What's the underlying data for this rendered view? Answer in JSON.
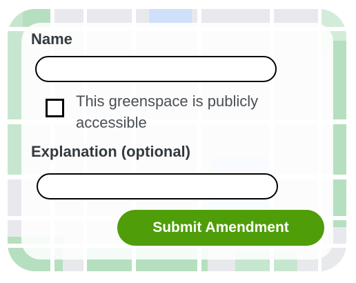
{
  "form": {
    "name_label": "Name",
    "name_value": "",
    "public_checkbox": {
      "label": "This greenspace is publicly accessible",
      "checked": false
    },
    "explanation_label": "Explanation (optional)",
    "explanation_value": "",
    "submit_label": "Submit Amendment"
  },
  "colors": {
    "accent": "#4f9d08",
    "map_park": "#b6dfc0",
    "map_water": "#cfe0fb",
    "map_road": "#ffffff",
    "map_land": "#e8e9ec"
  }
}
